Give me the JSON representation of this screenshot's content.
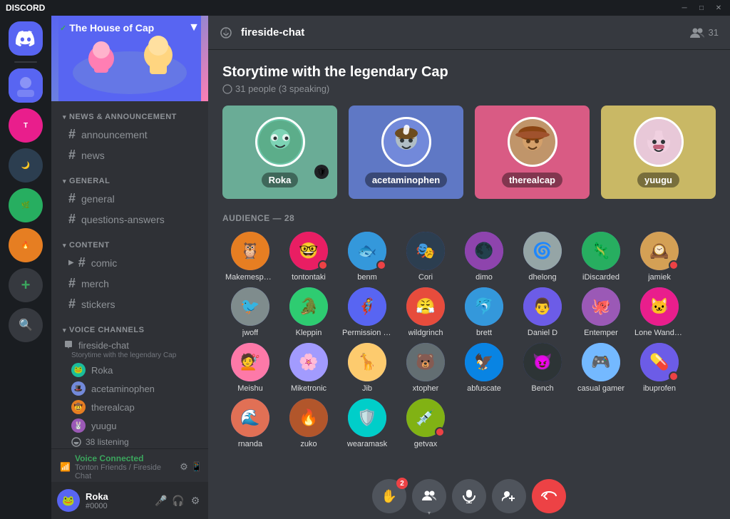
{
  "titlebar": {
    "app_name": "DISCORD",
    "minimize": "─",
    "maximize": "□",
    "close": "✕"
  },
  "server_icons": [
    {
      "id": "discord",
      "label": "Discord",
      "color": "#5865f2",
      "text": "🎮"
    },
    {
      "id": "s1",
      "label": "Server 1",
      "color": "#5865f2",
      "text": ""
    },
    {
      "id": "s2",
      "label": "Server 2",
      "color": "#e91e8c",
      "text": ""
    },
    {
      "id": "s3",
      "label": "Server 3",
      "color": "#3498db",
      "text": ""
    },
    {
      "id": "s4",
      "label": "Server 4",
      "color": "#2ecc71",
      "text": ""
    },
    {
      "id": "explore",
      "label": "Explore",
      "color": "#3ba55d",
      "text": "+"
    }
  ],
  "sidebar": {
    "server_name": "The House of Cap",
    "categories": [
      {
        "name": "NEWS & ANNOUNCEMENT",
        "channels": [
          {
            "name": "announcement",
            "active": false
          },
          {
            "name": "news",
            "active": false
          }
        ]
      },
      {
        "name": "GENERAL",
        "channels": [
          {
            "name": "general",
            "active": false
          },
          {
            "name": "questions-answers",
            "active": false
          }
        ]
      },
      {
        "name": "CONTENT",
        "channels": [
          {
            "name": "comic",
            "active": false,
            "has_arrow": true
          },
          {
            "name": "merch",
            "active": false
          },
          {
            "name": "stickers",
            "active": false
          }
        ]
      }
    ],
    "voice_channels_label": "VOICE CHANNELS",
    "voice_channel": {
      "name": "fireside-chat",
      "subtitle": "Storytime with the legendary Cap",
      "speakers": [
        {
          "name": "Roka",
          "color": "#5865f2"
        },
        {
          "name": "acetaminophen",
          "color": "#e91e8c"
        },
        {
          "name": "therealcap",
          "color": "#e67e22"
        },
        {
          "name": "yuugu",
          "color": "#9b59b6"
        }
      ],
      "listening_count": "38 listening"
    }
  },
  "footer": {
    "username": "Roka",
    "discriminator": "#0000",
    "voice_connected": "Voice Connected",
    "voice_sub": "Tonton Friends / Fireside Chat"
  },
  "header": {
    "channel_name": "fireside-chat",
    "members_count": "31"
  },
  "stage": {
    "title": "Storytime with the legendary Cap",
    "subtitle": "31 people (3 speaking)",
    "speakers": [
      {
        "name": "Roka",
        "bg": "#6aac96"
      },
      {
        "name": "acetaminophen",
        "bg": "#5f78c5"
      },
      {
        "name": "therealcap",
        "bg": "#d95b84"
      },
      {
        "name": "yuugu",
        "bg": "#c9b865"
      }
    ]
  },
  "audience": {
    "label": "AUDIENCE",
    "count": "28",
    "members": [
      {
        "name": "Makemespeakrr",
        "color": "#e67e22"
      },
      {
        "name": "tontontaki",
        "color": "#e91e63",
        "badge": true
      },
      {
        "name": "benm",
        "color": "#3498db",
        "badge": true
      },
      {
        "name": "Cori",
        "color": "#2c3e50"
      },
      {
        "name": "dimo",
        "color": "#8e44ad"
      },
      {
        "name": "dhelong",
        "color": "#95a5a6"
      },
      {
        "name": "iDiscarded",
        "color": "#27ae60"
      },
      {
        "name": "jamiek",
        "color": "#d4a055",
        "badge": true
      },
      {
        "name": "jwoff",
        "color": "#7f8c8d"
      },
      {
        "name": "Kleppin",
        "color": "#2ecc71"
      },
      {
        "name": "Permission Man",
        "color": "#5865f2"
      },
      {
        "name": "wildgrinch",
        "color": "#e74c3c"
      },
      {
        "name": "brett",
        "color": "#3498db"
      },
      {
        "name": "Daniel D",
        "color": "#6c5ce7"
      },
      {
        "name": "Entemper",
        "color": "#9b59b6"
      },
      {
        "name": "Lone Wanderer",
        "color": "#e91e8c"
      },
      {
        "name": "Meishu",
        "color": "#fd79a8"
      },
      {
        "name": "Miketronic",
        "color": "#a29bfe"
      },
      {
        "name": "Jib",
        "color": "#fdcb6e"
      },
      {
        "name": "xtopher",
        "color": "#636e72"
      },
      {
        "name": "abfuscate",
        "color": "#0984e3"
      },
      {
        "name": "Bench",
        "color": "#2d3436"
      },
      {
        "name": "casual gamer",
        "color": "#74b9ff"
      },
      {
        "name": "ibuprofen",
        "color": "#6c5ce7",
        "badge": true
      },
      {
        "name": "rnanda",
        "color": "#e17055"
      },
      {
        "name": "zuko",
        "color": "#b2562b"
      },
      {
        "name": "wearamask",
        "color": "#00cec9"
      },
      {
        "name": "getvax",
        "color": "#81b214",
        "badge": true
      }
    ]
  },
  "controls": [
    {
      "id": "raise-hand",
      "icon": "✋",
      "label": "Raise Hand",
      "badge": "2"
    },
    {
      "id": "add-member",
      "icon": "👥",
      "label": "Members",
      "has_caret": true
    },
    {
      "id": "mute",
      "icon": "🎤",
      "label": "Mute"
    },
    {
      "id": "add-user",
      "icon": "👤+",
      "label": "Add User"
    },
    {
      "id": "leave",
      "icon": "📞",
      "label": "Leave",
      "red": true
    }
  ]
}
